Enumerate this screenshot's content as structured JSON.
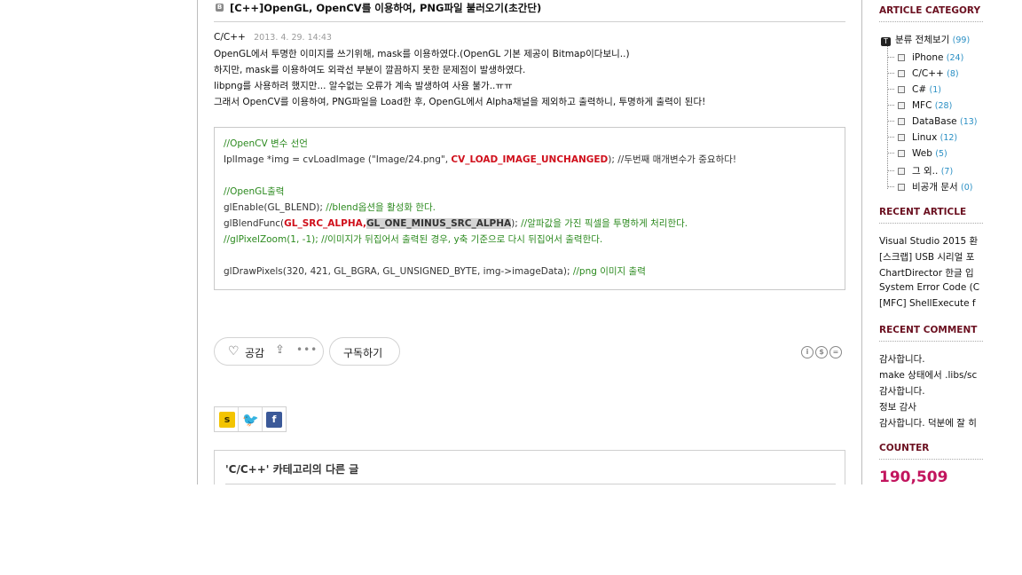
{
  "post": {
    "bullet": "B",
    "title": "[C++]OpenGL, OpenCV를 이용하여, PNG파일 불러오기(초간단)",
    "category": "C/C++",
    "date": "2013. 4. 29. 14:43",
    "body": [
      "OpenGL에서 투명한 이미지를 쓰기위해, mask를 이용하였다.(OpenGL 기본 제공이 Bitmap이다보니..)",
      "하지만, mask를 이용하여도 외곽선 부분이 깔끔하지 못한 문제점이 발생하였다.",
      "libpng를 사용하려 했지만... 알수없는 오류가 계속 발생하여 사용 불가..ㅠㅠ",
      "그래서 OpenCV를 이용하여, PNG파일을 Load한 후, OpenGL에서 Alpha채널을 제외하고 출력하니, 투명하게 출력이 된다!"
    ]
  },
  "code": {
    "l1": "//OpenCV 변수 선언",
    "l2a": "IplImage *img =  cvLoadImage (\"Image/24.png\", ",
    "l2b": "CV_LOAD_IMAGE_UNCHANGED",
    "l2c": "); //두번째 매개변수가 중요하다!",
    "l4": "//OpenGL출력",
    "l5a": "glEnable(GL_BLEND); ",
    "l5b": "//blend옵션을 활성화 한다.",
    "l6a": "glBlendFunc(",
    "l6b": "GL_SRC_ALPHA",
    "l6c": ",",
    "l6d": "GL_ONE_MINUS_SRC_ALPHA",
    "l6e": "); ",
    "l6f": "//알파값을 가진 픽셀을 투명하게 처리한다.",
    "l7a": "//glPixelZoom(1, -1); ",
    "l7b": "//이미지가 뒤집어서 출력된 경우, y축 기준으로 다시 뒤집어서 출력한다.",
    "l9a": "glDrawPixels(320, 421, GL_BGRA,   GL_UNSIGNED_BYTE, img->imageData); ",
    "l9b": "//png 이미지 출력"
  },
  "actions": {
    "like_label": "공감",
    "more": "•••",
    "subscribe_label": "구독하기"
  },
  "social": {
    "story": "s",
    "twitter": "🐦",
    "facebook": "f"
  },
  "related": {
    "title": "'C/C++' 카테고리의 다른 글"
  },
  "sidebar": {
    "category_head": "ARTICLE CATEGORY",
    "root_icon": "T",
    "root_label": "분류 전체보기",
    "root_count": "(99)",
    "categories": [
      {
        "label": "iPhone",
        "count": "(24)"
      },
      {
        "label": "C/C++",
        "count": "(8)"
      },
      {
        "label": "C#",
        "count": "(1)"
      },
      {
        "label": "MFC",
        "count": "(28)"
      },
      {
        "label": "DataBase",
        "count": "(13)"
      },
      {
        "label": "Linux",
        "count": "(12)"
      },
      {
        "label": "Web",
        "count": "(5)"
      },
      {
        "label": "그 외..",
        "count": "(7)"
      },
      {
        "label": "비공개 문서",
        "count": "(0)"
      }
    ],
    "recent_article_head": "RECENT ARTICLE",
    "recent_articles": [
      "Visual Studio 2015 환",
      "[스크랩] USB 시리얼 포",
      "ChartDirector 한글 입",
      "System Error Code (C",
      "[MFC] ShellExecute f"
    ],
    "recent_comment_head": "RECENT COMMENT",
    "recent_comments": [
      "감사합니다.",
      "make 상태에서 .libs/sc",
      "감사합니다.",
      "정보 감사",
      "감사합니다. 덕분에 잘 히"
    ],
    "counter_head": "COUNTER",
    "counter_value": "190,509"
  },
  "colors": {
    "sidebar_heading": "#6b1020",
    "comment_green": "#2c8a1f",
    "keyword_red": "#d0101c",
    "count_blue": "#2a8fc4",
    "counter_pink": "#c2155e"
  }
}
